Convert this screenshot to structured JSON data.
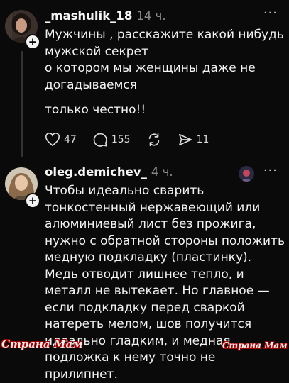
{
  "posts": [
    {
      "username": "_mashulik_18",
      "time": "14 ч.",
      "more": "···",
      "plus": "+",
      "paragraphs": [
        "Мужчины , расскажите какой нибудь мужской секрет",
        "о котором мы женщины  даже не догадываемся",
        "только честно!!"
      ],
      "actions": {
        "likes": "47",
        "comments": "155",
        "shares": "11"
      },
      "icons": [
        "heart-icon",
        "comment-icon",
        "repost-icon",
        "send-icon"
      ]
    },
    {
      "username": "oleg.demichev_",
      "time": "4 ч.",
      "more": "···",
      "plus": "+",
      "paragraphs": [
        "Чтобы идеально сварить тонкостенный нержавеющий или алюминиевый лист без прожига, нужно с обратной стороны положить медную подкладку (пластинку). Медь отводит лишнее тепло, и металл не вытекает. Но главное — если подкладку перед сваркой натереть мелом, шов получится идеально гладким, и медная подложка к нему точно не прилипнет."
      ]
    }
  ],
  "watermark": {
    "left": "Страна Мам",
    "right": "Страна Мам"
  },
  "colors": {
    "background": "#0a0a0a",
    "text": "#f3f3f3",
    "muted": "#8a8a8a",
    "watermark_outline": "#aa0000"
  }
}
